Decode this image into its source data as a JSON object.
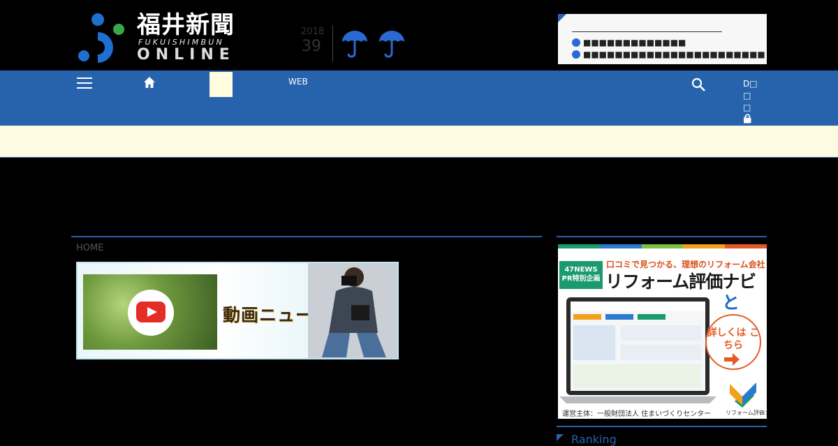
{
  "header": {
    "logo": {
      "kanji": "福井新聞",
      "romaji": "FUKUISHIMBUN",
      "online": "ONLINE"
    },
    "date": {
      "year": "2018",
      "number": "39"
    },
    "weather_icons": [
      "umbrella-icon",
      "umbrella-icon"
    ],
    "notices": {
      "items": [
        {
          "text": "■■■■■■■■■■■■■"
        },
        {
          "text": "■■■■■■■■■■■■■■■■■■■■■■■"
        }
      ]
    }
  },
  "nav": {
    "web_label": "WEB",
    "login_label": "D□□□□□"
  },
  "breadcrumb": {
    "home": "HOME"
  },
  "video_banner": {
    "title": "動画ニュース"
  },
  "ad": {
    "badge": "47NEWS PR特別企画",
    "headline": "口コミで見つかる、理想のリフォーム会社",
    "title": "リフォーム評価ナビ",
    "toha": "とは?",
    "cta": "詳しくは こちら",
    "logo_text": "リフォーム評価ナビ",
    "footer": "運営主体：一般財団法人 住まいづくりセンター"
  },
  "sidebar": {
    "ranking_label": "Ranking"
  },
  "colors": {
    "nav_blue": "#2762ad",
    "announce_bg": "#fdfbe1",
    "logo_blue": "#1f6fd0",
    "logo_green": "#3aa84a"
  }
}
